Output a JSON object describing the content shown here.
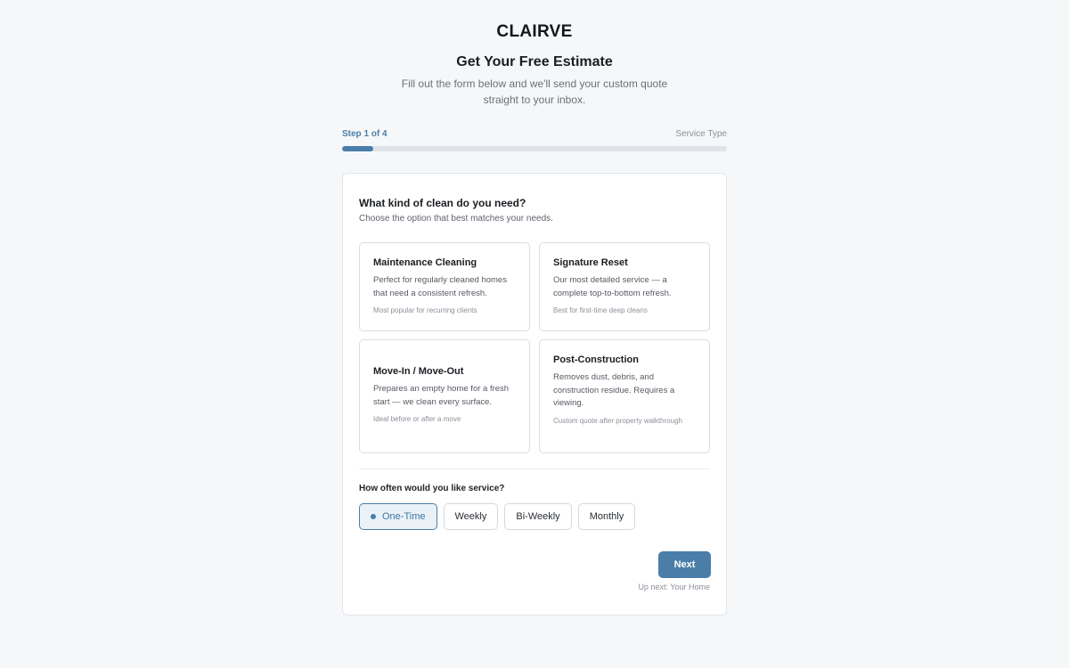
{
  "brand": "CLAIRVE",
  "heading": "Get Your Free Estimate",
  "subtext": "Fill out the form below and we'll send your custom quote straight to your inbox.",
  "progress": {
    "step_label": "Step 1 of 4",
    "step_name": "Service Type",
    "current_step": 1,
    "total_steps": 4,
    "fill_fraction": 0.08
  },
  "question": {
    "title": "What kind of clean do you need?",
    "subtitle": "Choose the option that best matches your needs."
  },
  "options": [
    {
      "title": "Maintenance Cleaning",
      "desc": "Perfect for regularly cleaned homes that need a consistent refresh.",
      "note": "Most popular for recurring clients"
    },
    {
      "title": "Signature Reset",
      "desc": "Our most detailed service — a complete top-to-bottom refresh.",
      "note": "Best for first-time deep cleans"
    },
    {
      "title": "Move-In / Move-Out",
      "desc": "Prepares an empty home for a fresh start — we clean every surface.",
      "note": "Ideal before or after a move"
    },
    {
      "title": "Post-Construction",
      "desc": "Removes dust, debris, and construction residue. Requires a viewing.",
      "note": "Custom quote after property walkthrough"
    }
  ],
  "frequency": {
    "label": "How often would you like service?",
    "options": [
      "One-Time",
      "Weekly",
      "Bi-Weekly",
      "Monthly"
    ],
    "selected": "One-Time"
  },
  "next_button": "Next",
  "up_next": "Up next: Your Home",
  "colors": {
    "accent": "#4a7ea8",
    "background": "#f6f7f9",
    "card": "#ffffff"
  }
}
